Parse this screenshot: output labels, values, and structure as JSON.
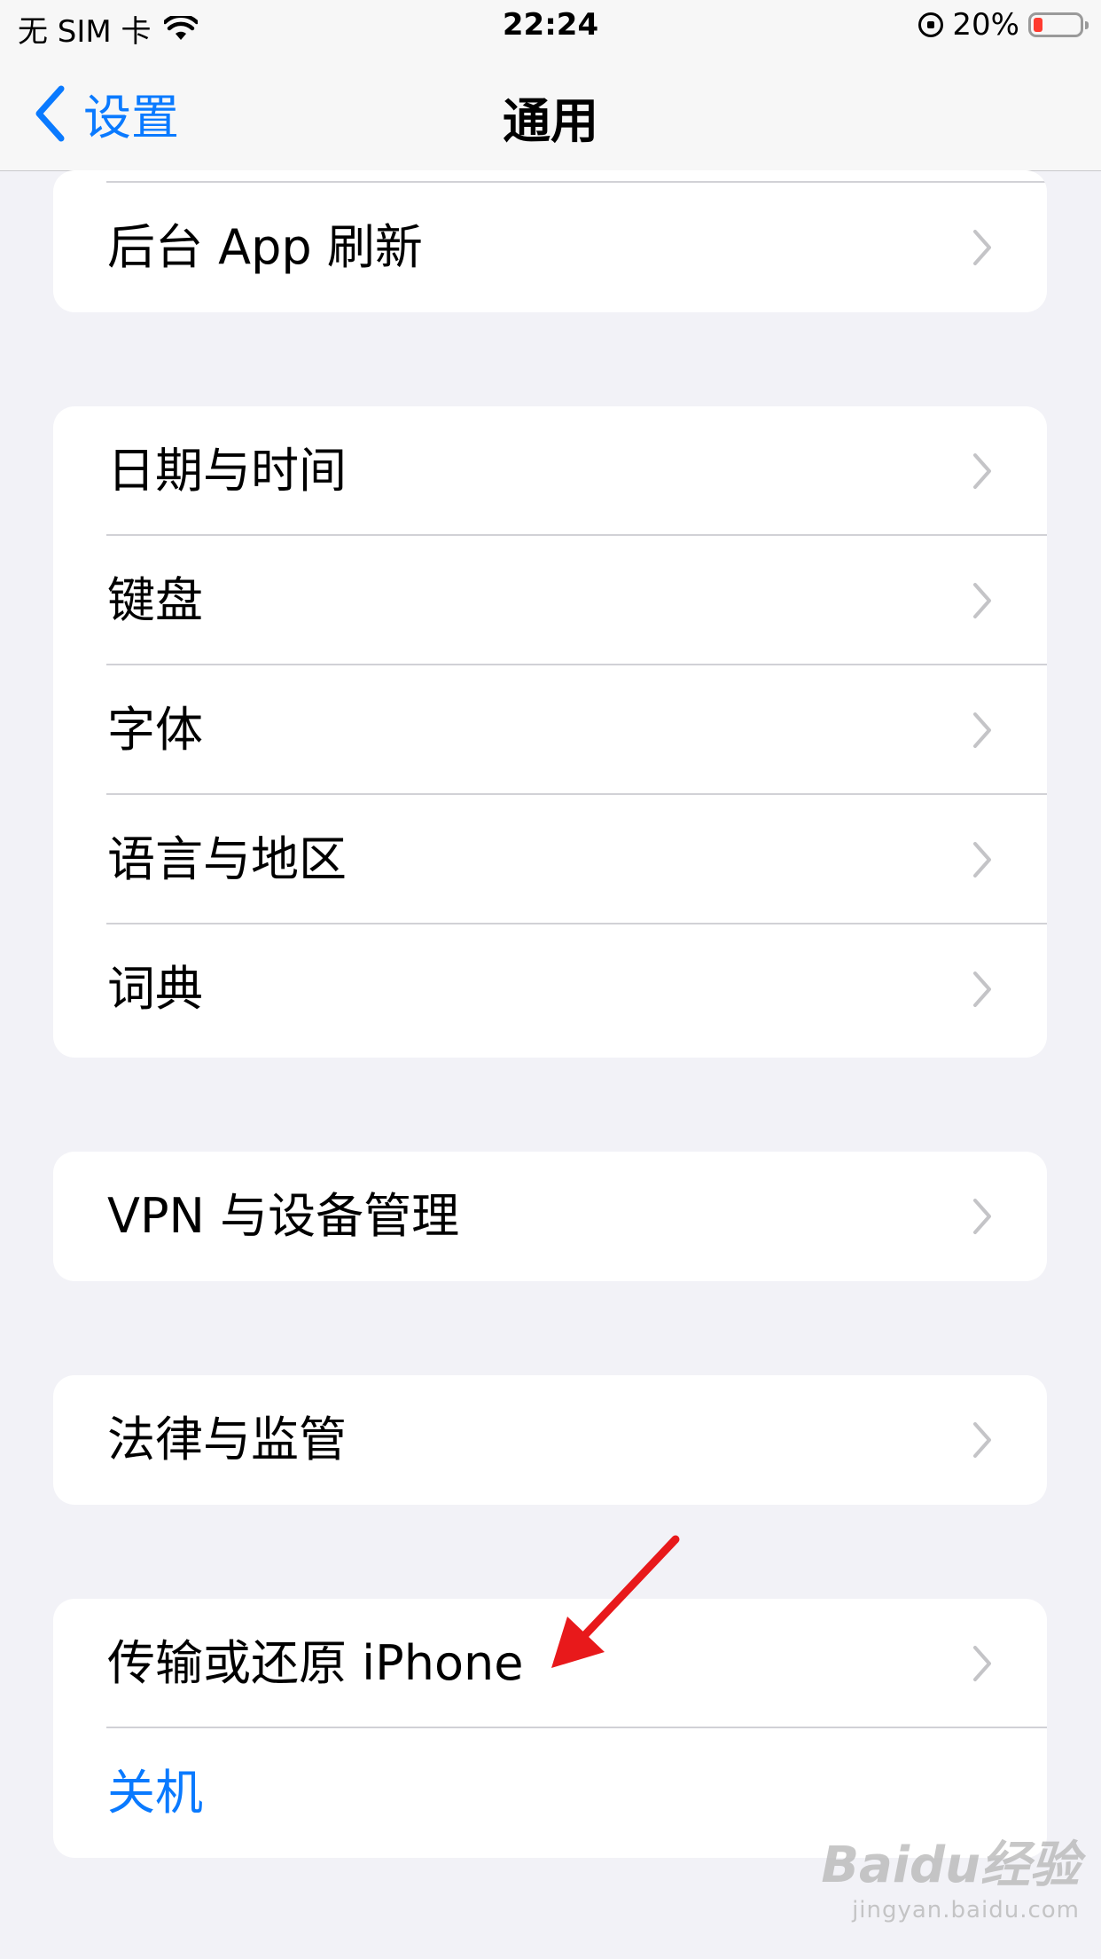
{
  "status_bar": {
    "carrier": "无 SIM 卡",
    "time": "22:24",
    "battery_percent": "20%",
    "battery_level": 0.2,
    "icons": [
      "wifi-icon",
      "rotation-lock-icon",
      "battery-icon"
    ]
  },
  "nav": {
    "back_label": "设置",
    "title": "通用"
  },
  "groups": {
    "g1": [
      "后台 App 刷新"
    ],
    "g2": [
      "日期与时间",
      "键盘",
      "字体",
      "语言与地区",
      "词典"
    ],
    "g3": [
      "VPN 与设备管理"
    ],
    "g4": [
      "法律与监管"
    ],
    "g5": [
      "传输或还原 iPhone",
      "关机"
    ]
  },
  "watermark": {
    "logo": "Baidu经验",
    "url": "jingyan.baidu.com"
  },
  "colors": {
    "accent": "#0a7aff",
    "background": "#f2f2f7",
    "annotation_arrow": "#e8191b",
    "battery_low": "#ff3b30"
  }
}
